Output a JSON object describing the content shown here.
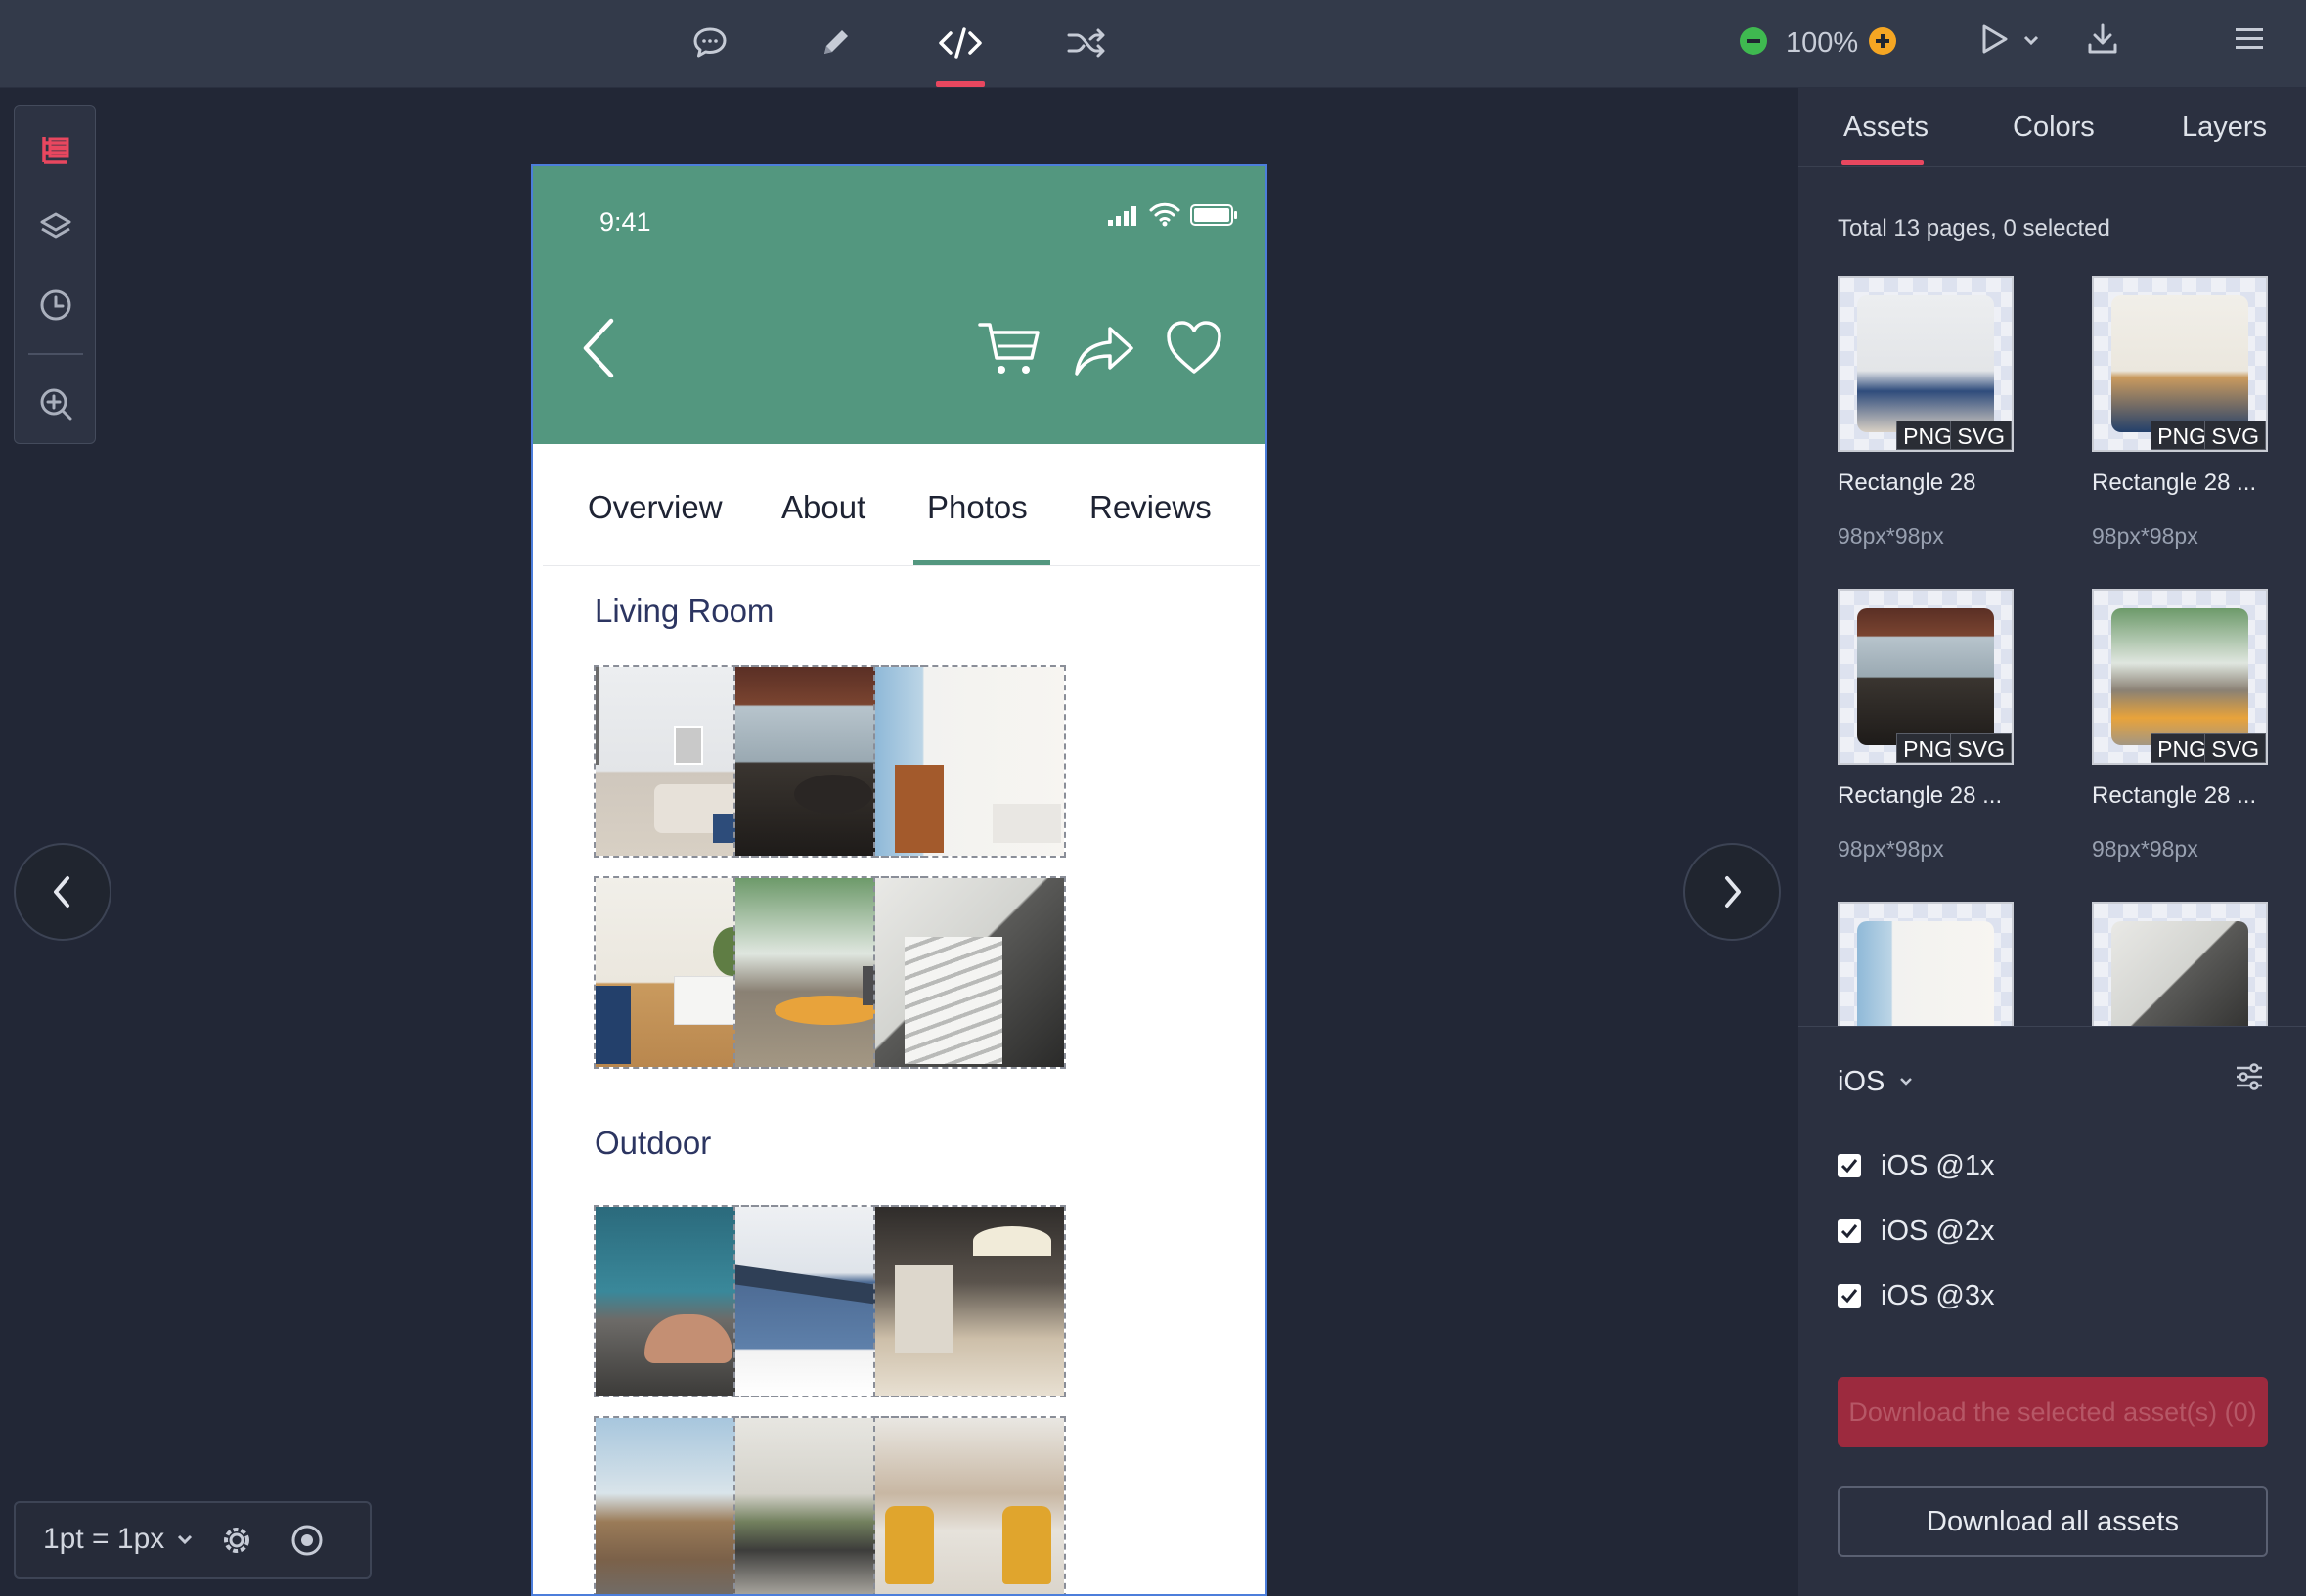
{
  "topbar": {
    "tools": [
      {
        "name": "comment-icon"
      },
      {
        "name": "pencil-icon"
      },
      {
        "name": "code-icon",
        "active": true
      },
      {
        "name": "shuffle-icon"
      }
    ],
    "zoom": "100%",
    "icons": [
      "minus-circle-icon",
      "plus-circle-icon",
      "play-icon",
      "chevron-down-icon",
      "download-icon",
      "menu-icon"
    ],
    "accent": "#e8475f"
  },
  "left_toolbar": {
    "icons": [
      "tree-icon",
      "layers-icon",
      "history-icon",
      "zoom-in-icon"
    ]
  },
  "scale": {
    "label": "1pt = 1px"
  },
  "phone": {
    "time": "9:41",
    "header_color": "#53977f",
    "tabs": [
      "Overview",
      "About",
      "Photos",
      "Reviews"
    ],
    "active_tab": "Photos",
    "sections": [
      {
        "title": "Living Room"
      },
      {
        "title": "Outdoor"
      }
    ]
  },
  "panel": {
    "tabs": [
      "Assets",
      "Colors",
      "Layers"
    ],
    "active_tab": "Assets",
    "total": "Total 13 pages, 0 selected",
    "assets": [
      {
        "name": "Rectangle 28",
        "size": "98px*98px",
        "badges": [
          "PNG",
          "SVG"
        ]
      },
      {
        "name": "Rectangle 28 ...",
        "size": "98px*98px",
        "badges": [
          "PNG",
          "SVG"
        ]
      },
      {
        "name": "Rectangle 28 ...",
        "size": "98px*98px",
        "badges": [
          "PNG",
          "SVG"
        ]
      },
      {
        "name": "Rectangle 28 ...",
        "size": "98px*98px",
        "badges": [
          "PNG",
          "SVG"
        ]
      }
    ],
    "platform": "iOS",
    "scales": [
      "iOS @1x",
      "iOS @2x",
      "iOS @3x"
    ],
    "download_selected": "Download the selected asset(s) (0)",
    "download_all": "Download all assets"
  }
}
